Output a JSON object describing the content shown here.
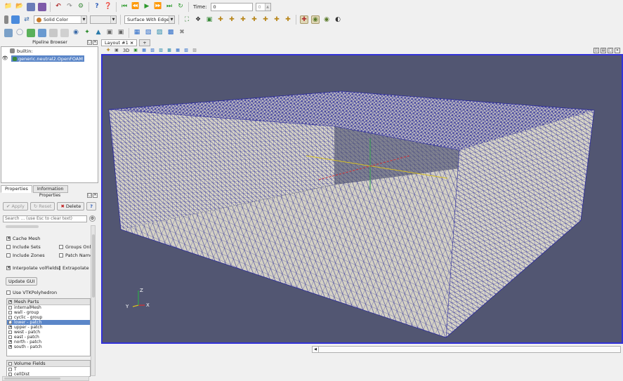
{
  "toolbar": {
    "color_combo": "Solid Color",
    "component_combo": "",
    "representation_combo": "Surface With Edges",
    "time_label": "Time:",
    "time_value": "0",
    "time_step": "0"
  },
  "pipeline": {
    "title": "Pipeline Browser",
    "root": "builtin:",
    "source": "generic.neutral2.OpenFOAM"
  },
  "properties": {
    "tabs": [
      "Properties",
      "Information"
    ],
    "title": "Properties",
    "apply": "Apply",
    "reset": "Reset",
    "delete": "Delete",
    "help": "?",
    "search_placeholder": "Search ... (use Esc to clear text)",
    "cache_mesh": "Cache Mesh",
    "include_sets": "Include Sets",
    "groups_only": "Groups Only",
    "include_zones": "Include Zones",
    "patch_names": "Patch Names",
    "interpolate_volfields": "Interpolate volFields",
    "extrapolate": "Extrapolate P",
    "update_gui": "Update GUI",
    "use_vtkpolyhedron": "Use VTKPolyhedron",
    "mesh_parts_header": "Mesh Parts",
    "mesh_parts": [
      {
        "label": "internalMesh",
        "checked": false,
        "selected": false
      },
      {
        "label": "wall - group",
        "checked": false,
        "selected": false
      },
      {
        "label": "cyclic - group",
        "checked": false,
        "selected": false
      },
      {
        "label": "lower - patch",
        "checked": true,
        "selected": true
      },
      {
        "label": "upper - patch",
        "checked": true,
        "selected": false
      },
      {
        "label": "west - patch",
        "checked": false,
        "selected": false
      },
      {
        "label": "east - patch",
        "checked": false,
        "selected": false
      },
      {
        "label": "north - patch",
        "checked": true,
        "selected": false
      },
      {
        "label": "south - patch",
        "checked": true,
        "selected": false
      }
    ],
    "volume_fields_header": "Volume Fields",
    "volume_fields": [
      "T",
      "cellDist"
    ]
  },
  "view": {
    "layout_tab": "Layout #1",
    "add_tab": "+",
    "mode_3d": "3D",
    "axes": {
      "x": "X",
      "y": "Y",
      "z": "Z"
    }
  },
  "colors": {
    "background": "#525672",
    "mesh_face": "#d9d6c7",
    "mesh_edge": "#2a2a9a",
    "selection": "#5b86c8",
    "viewport_border": "#3232d8"
  }
}
